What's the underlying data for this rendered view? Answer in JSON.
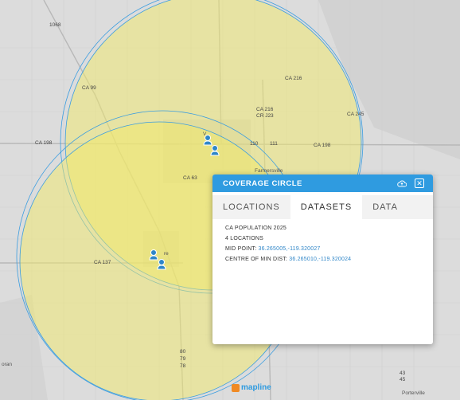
{
  "map": {
    "labels": {
      "hwy_1068": "1068",
      "ca99": "CA 99",
      "ca216_top": "CA 216",
      "ca216_mid": "CA 216",
      "cr_j23": "CR J23",
      "ca245": "CA 245",
      "ca198_left": "CA 198",
      "ca198_right": "CA 198",
      "ca63": "CA 63",
      "ca137": "CA 137",
      "farmersville": "Farmersville",
      "porterville": "Porterville",
      "oran": "oran",
      "visalia_v": "V",
      "tulare_frag": "re",
      "exit_110": "110",
      "exit_111": "111",
      "exit_43": "43",
      "exit_45": "45",
      "exit_80": "80",
      "exit_79": "79",
      "exit_78": "78"
    },
    "colors": {
      "coverage_fill": "#f2ea6a",
      "coverage_stroke": "#3a9de0",
      "marker": "#2f86c8"
    }
  },
  "popup": {
    "title": "COVERAGE CIRCLE",
    "cloud_icon": "cloud-icon",
    "close_icon": "close-icon",
    "tabs": [
      "LOCATIONS",
      "DATASETS",
      "DATA"
    ],
    "active_tab": "DATASETS",
    "dataset_name": "CA POPULATION 2025",
    "locations_count": "4 LOCATIONS",
    "mid_point_label": "MID POINT:",
    "mid_point_value": "36.265005,-119.320027",
    "centre_label": "CENTRE OF MIN DIST:",
    "centre_value": "36.265010,-119.320024"
  },
  "brand": {
    "logo_text": "mapline"
  }
}
